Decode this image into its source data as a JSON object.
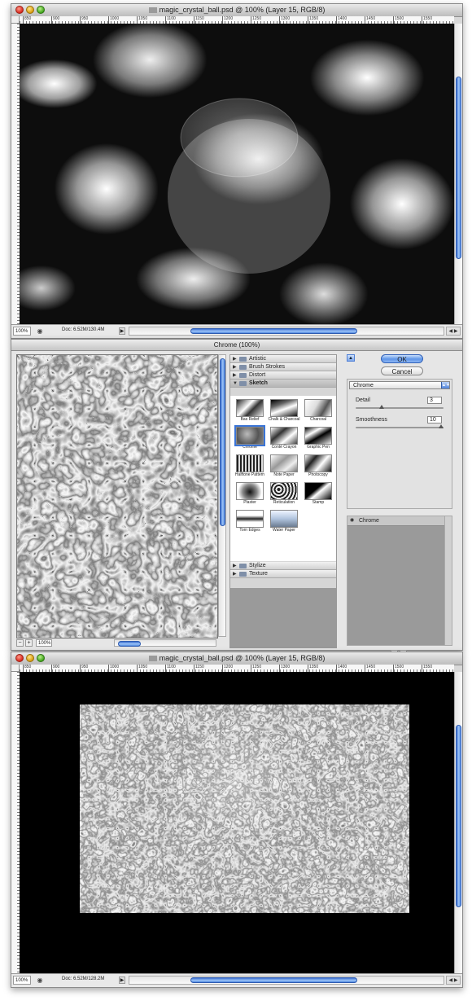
{
  "top_window": {
    "title": "magic_crystal_ball.psd @ 100% (Layer 15, RGB/8)",
    "ruler_ticks": [
      "850",
      "900",
      "950",
      "1000",
      "1050",
      "1100",
      "1150",
      "1200",
      "1250",
      "1300",
      "1350",
      "1400",
      "1450",
      "1500",
      "1550"
    ],
    "status": {
      "zoom": "100%",
      "doc_info": "Doc: 6.52M/130.4M"
    }
  },
  "filter_gallery": {
    "title": "Chrome (100%)",
    "preview_zoom": "100%",
    "categories_top": [
      "Artistic",
      "Brush Strokes",
      "Distort"
    ],
    "open_category": "Sketch",
    "filters": [
      "Bas Relief",
      "Chalk & Charcoal",
      "Charcoal",
      "Chrome",
      "Conté Crayon",
      "Graphic Pen",
      "Halftone Pattern",
      "Note Paper",
      "Photocopy",
      "Plaster",
      "Reticulation",
      "Stamp",
      "Torn Edges",
      "Water Paper"
    ],
    "selected_filter": "Chrome",
    "categories_bottom": [
      "Stylize",
      "Texture"
    ],
    "ok_label": "OK",
    "cancel_label": "Cancel",
    "filter_select": "Chrome",
    "params": [
      {
        "label": "Detail",
        "value": "3",
        "slider": 0.3
      },
      {
        "label": "Smoothness",
        "value": "10",
        "slider": 1.0
      }
    ],
    "effect_layer": "Chrome"
  },
  "bottom_window": {
    "title": "magic_crystal_ball.psd @ 100% (Layer 15, RGB/8)",
    "ruler_ticks": [
      "850",
      "900",
      "950",
      "1000",
      "1050",
      "1100",
      "1150",
      "1200",
      "1250",
      "1300",
      "1350",
      "1400",
      "1450",
      "1500",
      "1550"
    ],
    "status": {
      "zoom": "100%",
      "doc_info": "Doc: 6.52M/128.2M"
    }
  }
}
